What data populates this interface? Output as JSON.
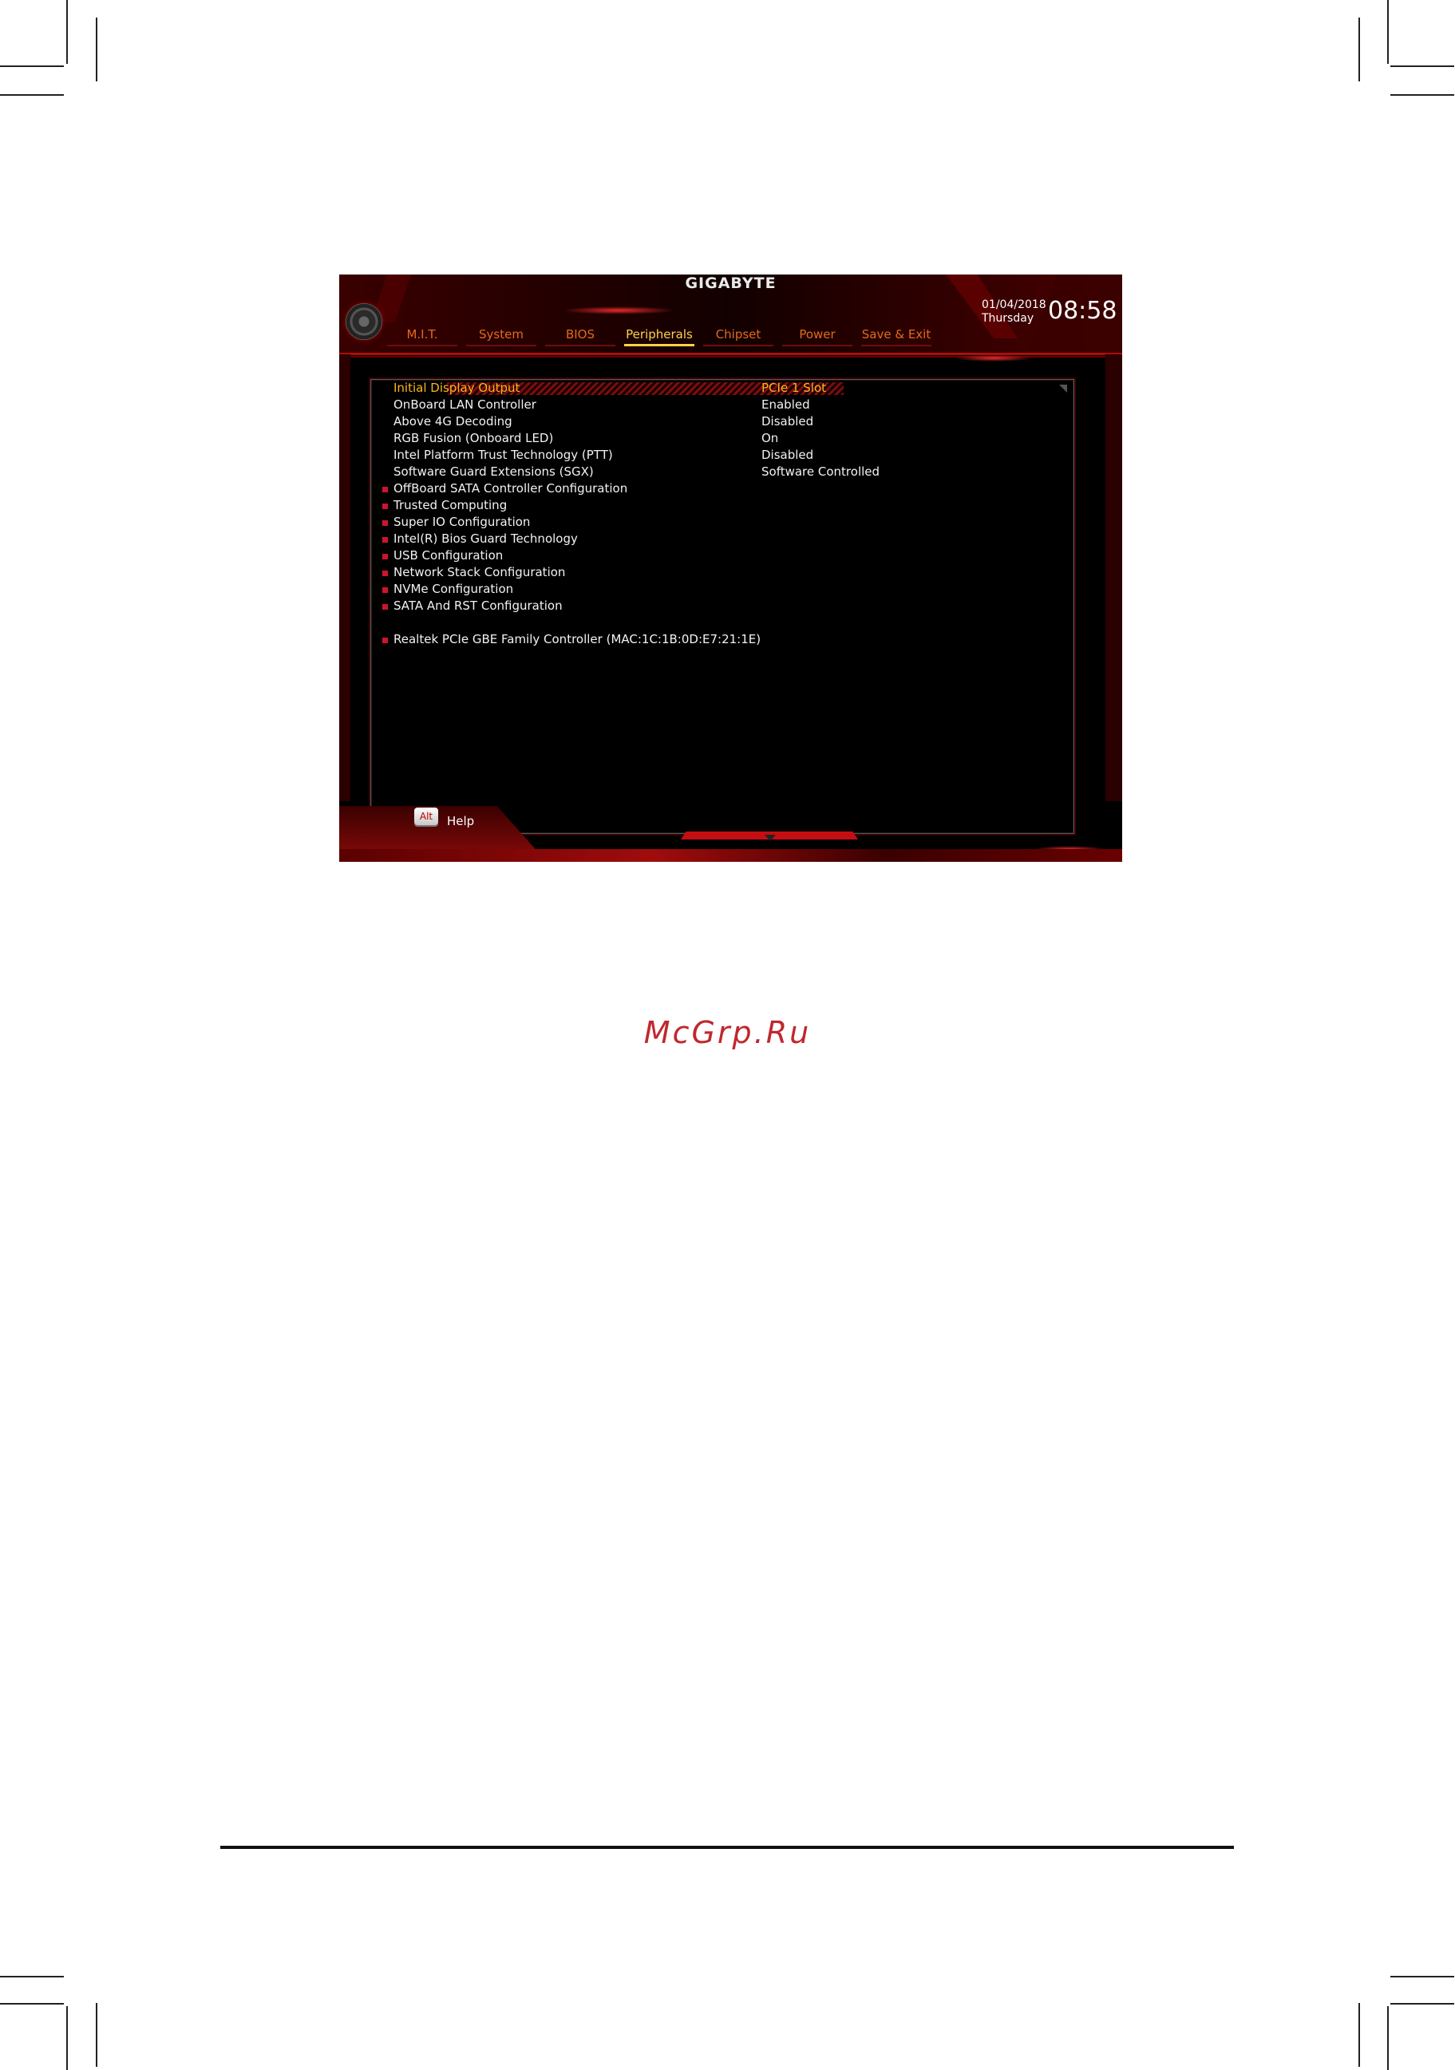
{
  "bios": {
    "brand": "GIGABYTE",
    "date": "01/04/2018",
    "weekday": "Thursday",
    "time": "08:58",
    "tabs": [
      {
        "label": "M.I.T."
      },
      {
        "label": "System"
      },
      {
        "label": "BIOS"
      },
      {
        "label": "Peripherals"
      },
      {
        "label": "Chipset"
      },
      {
        "label": "Power"
      },
      {
        "label": "Save & Exit"
      }
    ],
    "active_tab": "Peripherals",
    "settings": [
      {
        "label": "Initial Display Output",
        "value": "PCIe 1 Slot"
      },
      {
        "label": "OnBoard LAN Controller",
        "value": "Enabled"
      },
      {
        "label": "Above 4G Decoding",
        "value": "Disabled"
      },
      {
        "label": "RGB Fusion (Onboard LED)",
        "value": "On"
      },
      {
        "label": "Intel Platform Trust Technology (PTT)",
        "value": "Disabled"
      },
      {
        "label": "Software Guard Extensions (SGX)",
        "value": "Software Controlled"
      }
    ],
    "submenus": [
      {
        "label": "OffBoard SATA Controller Configuration"
      },
      {
        "label": "Trusted Computing"
      },
      {
        "label": "Super IO Configuration"
      },
      {
        "label": "Intel(R) Bios Guard Technology"
      },
      {
        "label": "USB Configuration"
      },
      {
        "label": "Network Stack Configuration"
      },
      {
        "label": "NVMe Configuration"
      },
      {
        "label": "SATA And RST Configuration"
      },
      {
        "label": "Realtek PCIe GBE Family Controller (MAC:1C:1B:0D:E7:21:1E)"
      }
    ],
    "footer": {
      "key": "Alt",
      "help": "Help"
    }
  },
  "watermark": "McGrp.Ru",
  "colors": {
    "accent_red": "#d0142c",
    "tab_orange": "#e56a1a",
    "selected_yellow": "#ffb419"
  }
}
